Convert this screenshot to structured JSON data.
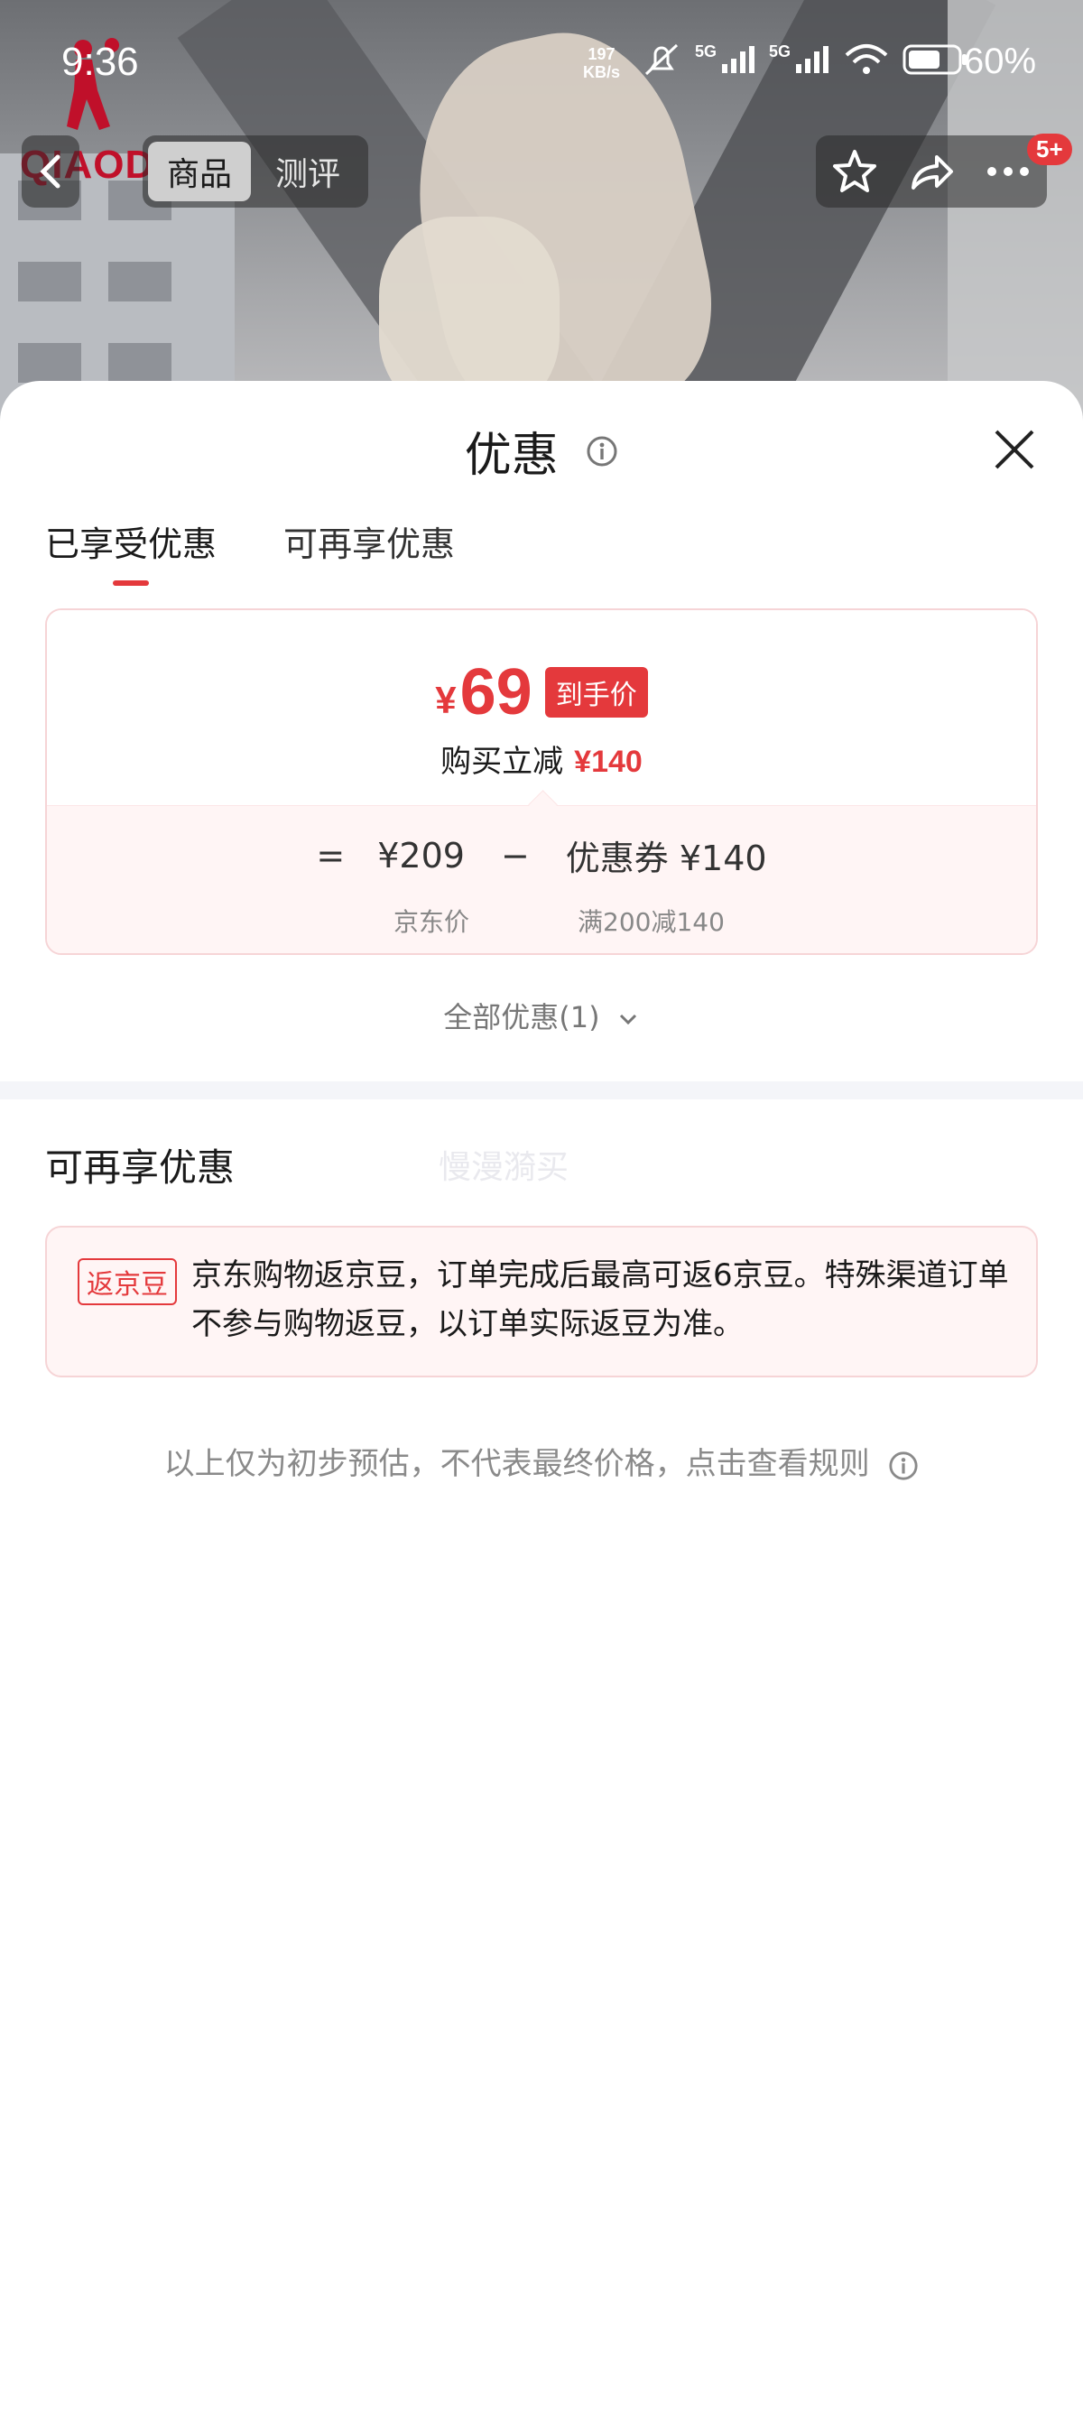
{
  "status_bar": {
    "time": "9:36",
    "net_rate_value": "197",
    "net_rate_unit": "KB/s",
    "signal1": "5G",
    "signal2": "5G",
    "battery": "60%"
  },
  "brand_logo": "QIAODAN",
  "top_nav": {
    "tabs": [
      {
        "label": "商品",
        "active": true
      },
      {
        "label": "测评",
        "active": false
      }
    ],
    "badge": "5+",
    "icons": [
      "back-icon",
      "star-icon",
      "share-icon",
      "more-icon"
    ]
  },
  "sheet": {
    "title": "优惠",
    "tabs": [
      {
        "label": "已享受优惠",
        "active": true
      },
      {
        "label": "可再享优惠",
        "active": false
      }
    ],
    "price": {
      "currency": "¥",
      "value": "69",
      "tag": "到手价",
      "reduce_label": "购买立减",
      "reduce_amount": "¥140"
    },
    "formula": {
      "eq": "=",
      "base": "¥209",
      "base_label": "京东价",
      "minus": "−",
      "coupon": "优惠券 ¥140",
      "coupon_label": "满200减140"
    },
    "all_offers": "全部优惠(1)",
    "section2_title": "可再享优惠",
    "watermark": "慢漫漪买",
    "bean": {
      "tag": "返京豆",
      "text": "京东购物返京豆，订单完成后最高可返6京豆。特殊渠道订单不参与购物返豆，以订单实际返豆为准。"
    },
    "disclaimer": "以上仅为初步预估，不代表最终价格，点击查看规则"
  },
  "colors": {
    "accent": "#e4393c",
    "card_bg": "#fff5f5",
    "divider": "#f4f5f9"
  }
}
